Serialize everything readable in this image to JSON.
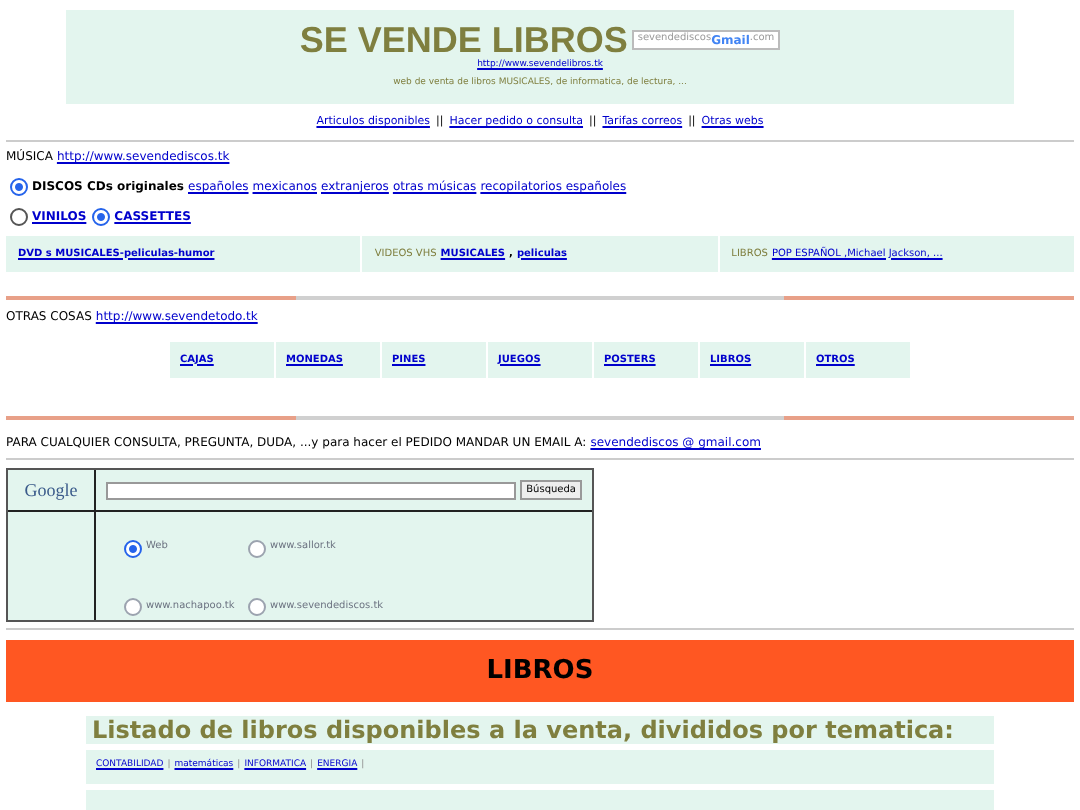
{
  "header": {
    "title": "SE VENDE LIBROS",
    "email_badge": {
      "user": "sevendediscos",
      "brand": "Gmail",
      "domain": ".com"
    },
    "url": "http://www.sevendelibros.tk",
    "tagline": "web de venta de libros MUSICALES, de informatica, de lectura, ..."
  },
  "nav_links": [
    "Articulos disponibles",
    "Hacer pedido o consulta",
    "Tarifas correos",
    "Otras webs"
  ],
  "nav_separator": "||",
  "music": {
    "label": "MÚSICA",
    "url": "http://www.sevendediscos.tk"
  },
  "music_options": [
    {
      "label": "DISCOS CDs originales",
      "selected": true,
      "links": [
        "españoles",
        "mexicanos",
        "extranjeros",
        "otras músicas",
        "recopilatorios españoles"
      ]
    },
    {
      "label": "VINILOS",
      "selected": false
    },
    {
      "label": "CASSETTES",
      "selected": true
    }
  ],
  "media_cells": [
    {
      "links": [
        "DVD s MUSICALES-peliculas-humor"
      ]
    },
    {
      "prefix": "VIDEOS VHS",
      "links": [
        "MUSICALES",
        "peliculas"
      ],
      "separator": ","
    },
    {
      "prefix": "LIBROS",
      "links": [
        "POP ESPAÑOL ,Michael Jackson, ..."
      ]
    }
  ],
  "other": {
    "label": "OTRAS COSAS",
    "url": "http://www.sevendetodo.tk"
  },
  "categories": [
    "CAJAS",
    "MONEDAS",
    "PINES",
    "JUEGOS",
    "POSTERS",
    "LIBROS",
    "OTROS"
  ],
  "contact": {
    "text": "PARA CUALQUIER CONSULTA, PREGUNTA, DUDA, ...y para hacer el PEDIDO MANDAR UN EMAIL A:",
    "email": "sevendediscos @ gmail.com"
  },
  "search": {
    "logo": "Google",
    "button": "Búsqueda",
    "scopes": [
      {
        "label": "Web",
        "selected": true
      },
      {
        "label": "www.sallor.tk",
        "selected": false
      },
      {
        "label": "www.nachapoo.tk",
        "selected": false
      },
      {
        "label": "www.sevendediscos.tk",
        "selected": false
      }
    ]
  },
  "banner": "LIBROS",
  "listing": {
    "heading": "Listado de libros disponibles a la venta, divididos por tematica:",
    "topics": [
      "CONTABILIDAD",
      "matemáticas",
      "INFORMATICA",
      "ENERGIA"
    ],
    "separator": "|"
  }
}
